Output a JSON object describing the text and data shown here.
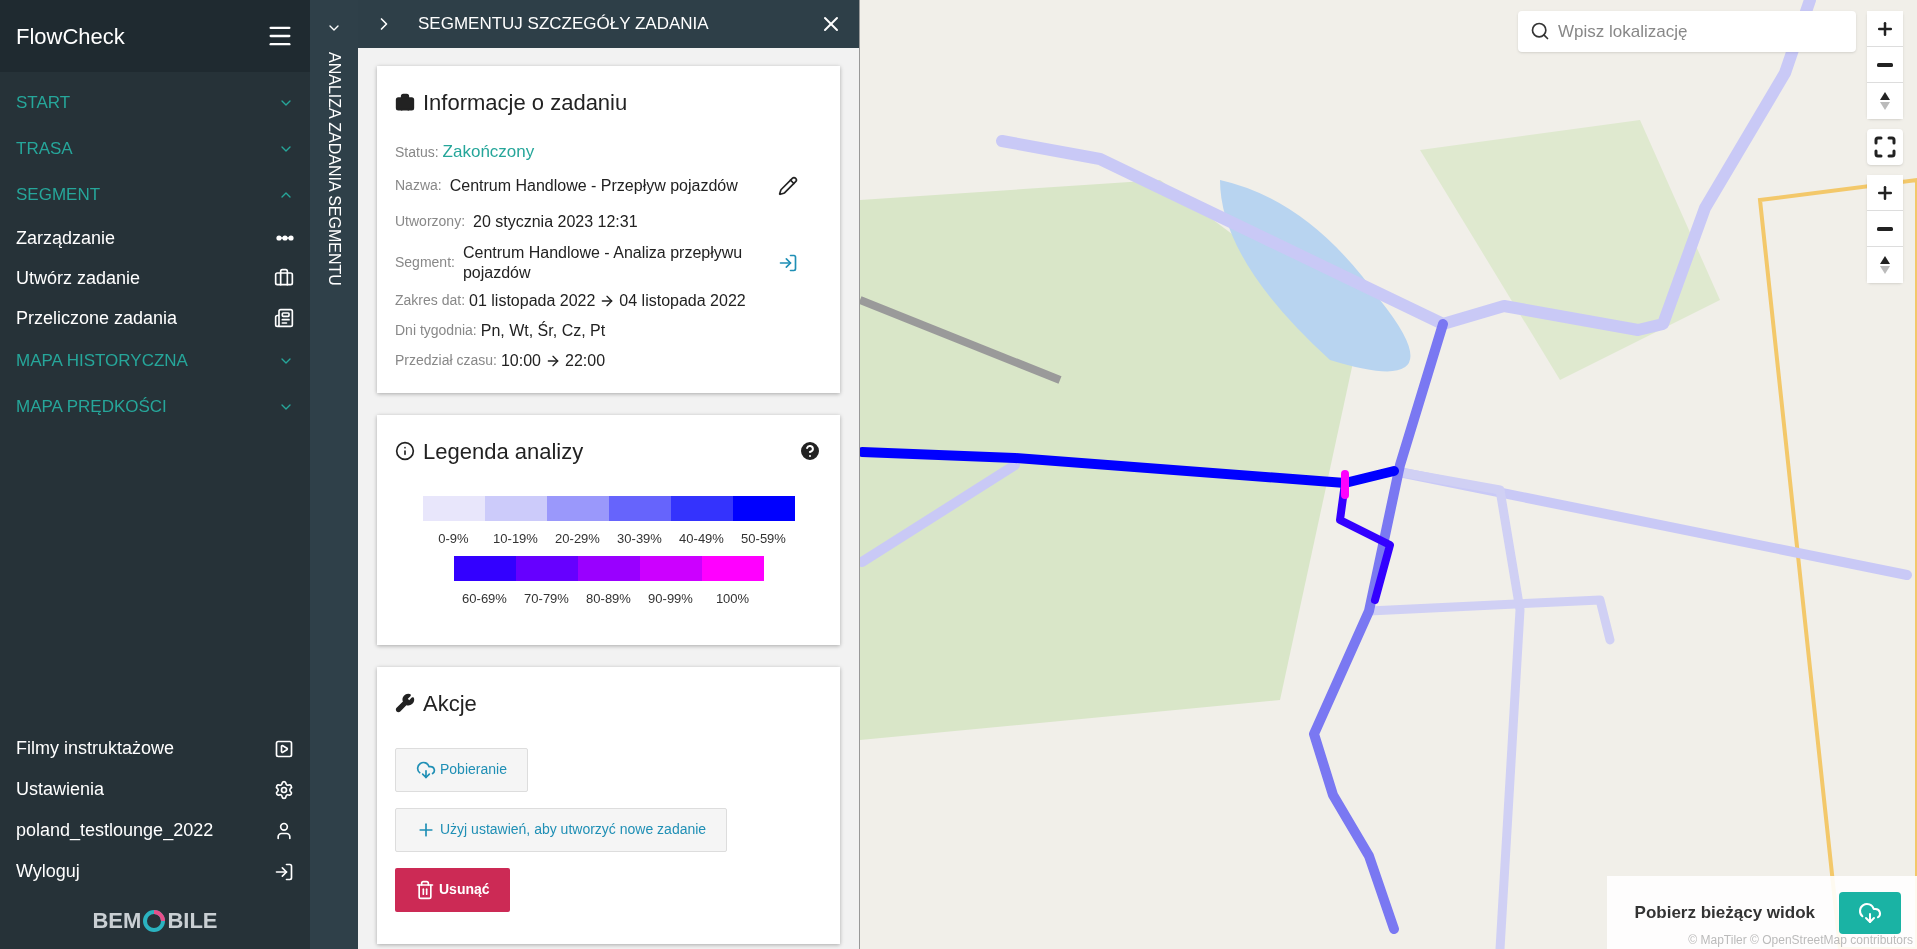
{
  "sidebar": {
    "title": "FlowCheck",
    "sections": [
      {
        "label": "START",
        "expanded": false
      },
      {
        "label": "TRASA",
        "expanded": false
      },
      {
        "label": "SEGMENT",
        "expanded": true,
        "items": [
          {
            "label": "Zarządzanie"
          },
          {
            "label": "Utwórz zadanie"
          },
          {
            "label": "Przeliczone zadania"
          }
        ]
      },
      {
        "label": "MAPA HISTORYCZNA",
        "expanded": false
      },
      {
        "label": "MAPA PRĘDKOŚCI",
        "expanded": false
      }
    ],
    "footer_items": [
      {
        "label": "Filmy instruktażowe"
      },
      {
        "label": "Ustawienia"
      },
      {
        "label": "poland_testlounge_2022"
      },
      {
        "label": "Wyloguj"
      }
    ],
    "logo": {
      "left": "BEM",
      "right": "BILE"
    }
  },
  "side_tab": {
    "label": "ANALIZA ZADANIA SEGMENTU"
  },
  "panel": {
    "title": "SEGMENTUJ SZCZEGÓŁY ZADANIA",
    "info": {
      "title": "Informacje o zadaniu",
      "status": {
        "label": "Status:",
        "value": "Zakończony"
      },
      "fields": [
        {
          "label": "Nazwa:",
          "value": "Centrum Handlowe - Przepływ pojazdów",
          "kind": "editable"
        },
        {
          "label": "Utworzony:",
          "value": "20 stycznia 2023 12:31",
          "kind": "plain"
        },
        {
          "label": "Segment:",
          "value": "Centrum Handlowe - Analiza przepływu pojazdów",
          "kind": "link"
        }
      ],
      "ranges": [
        {
          "label": "Zakres dat:",
          "from": "01 listopada 2022",
          "to": "04 listopada 2022"
        }
      ],
      "days": {
        "label": "Dni tygodnia:",
        "value": "Pn, Wt, Śr, Cz, Pt"
      },
      "time": {
        "label": "Przedział czasu:",
        "from": "10:00",
        "to": "22:00"
      }
    },
    "legend": {
      "title": "Legenda analizy",
      "rows": [
        [
          {
            "label": "0-9%",
            "color": "#e8e6fb"
          },
          {
            "label": "10-19%",
            "color": "#cccbfa"
          },
          {
            "label": "20-29%",
            "color": "#9a98fb"
          },
          {
            "label": "30-39%",
            "color": "#6664fc"
          },
          {
            "label": "40-49%",
            "color": "#3433fd"
          },
          {
            "label": "50-59%",
            "color": "#0000ff"
          }
        ],
        [
          {
            "label": "60-69%",
            "color": "#3300ff"
          },
          {
            "label": "70-79%",
            "color": "#6600ff"
          },
          {
            "label": "80-89%",
            "color": "#9900ff"
          },
          {
            "label": "90-99%",
            "color": "#cc00ff"
          },
          {
            "label": "100%",
            "color": "#ff00ff"
          }
        ]
      ]
    },
    "actions": {
      "title": "Akcje",
      "buttons": [
        {
          "label": "Pobieranie",
          "kind": "download"
        },
        {
          "label": "Użyj ustawień, aby utworzyć nowe zadanie",
          "kind": "create"
        },
        {
          "label": "Usunąć",
          "kind": "delete"
        }
      ]
    }
  },
  "map": {
    "search": {
      "placeholder": "Wpisz lokalizację"
    },
    "export": {
      "label": "Pobierz bieżący widok"
    },
    "attribution": "© MapTiler © OpenStreetMap contributors"
  }
}
